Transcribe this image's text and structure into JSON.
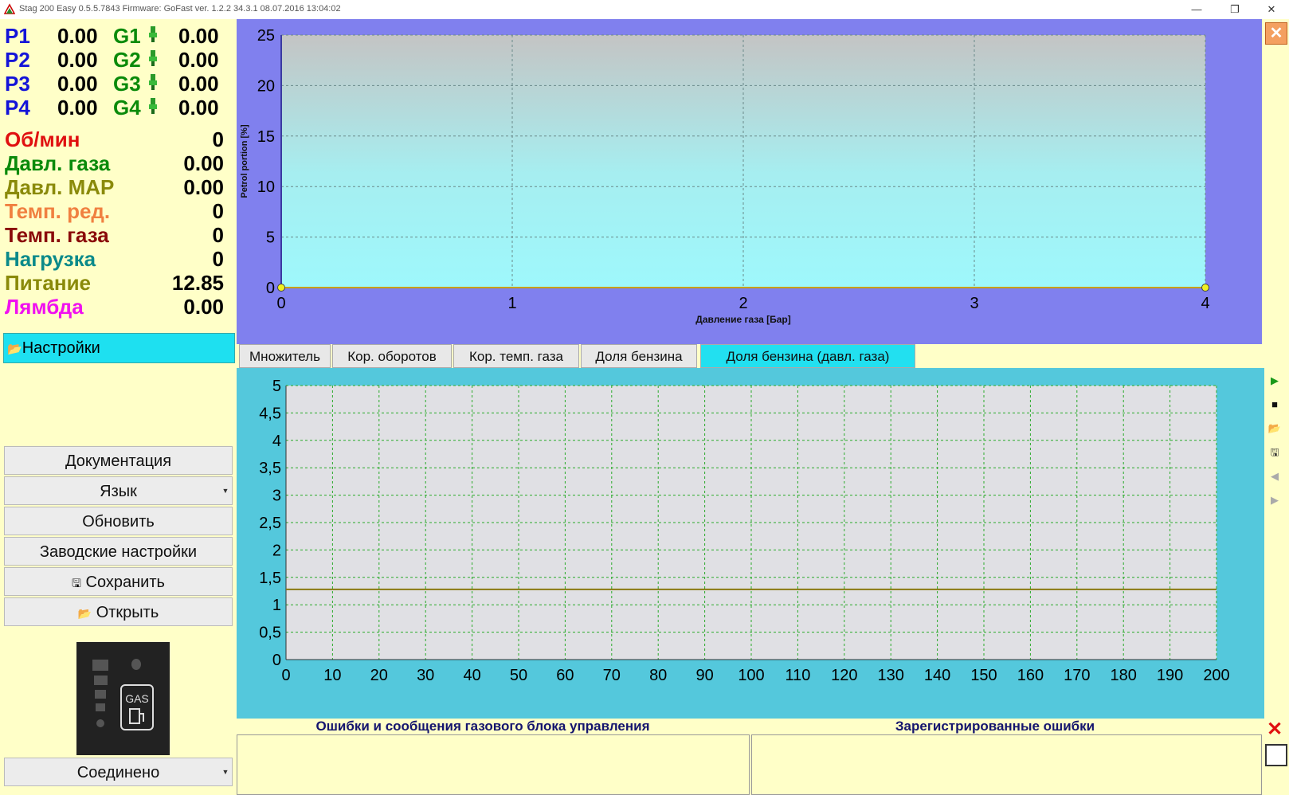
{
  "window": {
    "title": "Stag 200 Easy 0.5.5.7843 Firmware: GoFast  ver. 1.2.2  34.3.1   08.07.2016 13:04:02",
    "minimize": "—",
    "restore": "❐",
    "close": "✕"
  },
  "injectors": [
    {
      "p_label": "P1",
      "p_value": "0.00",
      "g_label": "G1",
      "g_value": "0.00"
    },
    {
      "p_label": "P2",
      "p_value": "0.00",
      "g_label": "G2",
      "g_value": "0.00"
    },
    {
      "p_label": "P3",
      "p_value": "0.00",
      "g_label": "G3",
      "g_value": "0.00"
    },
    {
      "p_label": "P4",
      "p_value": "0.00",
      "g_label": "G4",
      "g_value": "0.00"
    }
  ],
  "sensors": [
    {
      "label": "Об/мин",
      "value": "0",
      "color": "#e01010"
    },
    {
      "label": "Давл. газа",
      "value": "0.00",
      "color": "#0a8a0a"
    },
    {
      "label": "Давл. MAP",
      "value": "0.00",
      "color": "#8a8a0a"
    },
    {
      "label": "Темп. ред.",
      "value": "0",
      "color": "#f08040"
    },
    {
      "label": "Темп. газа",
      "value": "0",
      "color": "#8a0a0a"
    },
    {
      "label": "Нагрузка",
      "value": "0",
      "color": "#0a8a8a"
    },
    {
      "label": "Питание",
      "value": "12.85",
      "color": "#8a8a0a"
    },
    {
      "label": "Лямбда",
      "value": "0.00",
      "color": "#f010f0"
    }
  ],
  "settings_label": "Настройки",
  "buttons": {
    "documentation": "Документация",
    "language": "Язык",
    "refresh": "Обновить",
    "factory": "Заводские настройки",
    "save": "Сохранить",
    "open": "Открыть",
    "connection": "Соединено"
  },
  "gas_indicator": {
    "label": "GAS"
  },
  "tabs": [
    {
      "label": "Множитель",
      "active": false
    },
    {
      "label": "Кор. оборотов",
      "active": false
    },
    {
      "label": "Кор. темп. газа",
      "active": false
    },
    {
      "label": "Доля бензина",
      "active": false
    },
    {
      "label": "Доля бензина (давл. газа)",
      "active": true
    }
  ],
  "errors": {
    "ecu_messages_title": "Ошибки и сообщения газового блока управления",
    "registered_title": "Зарегистрированные ошибки"
  },
  "chart_data": [
    {
      "type": "line",
      "xlabel": "Давление газа [Бар]",
      "ylabel": "Petrol portion [%]",
      "xlim": [
        0,
        4
      ],
      "ylim": [
        0,
        25
      ],
      "x_ticks": [
        "0",
        "1",
        "2",
        "3",
        "4"
      ],
      "y_ticks": [
        "0",
        "5",
        "10",
        "15",
        "20",
        "25"
      ],
      "series": [
        {
          "x": [
            0,
            4
          ],
          "y": [
            0,
            0
          ],
          "color": "#c8a000"
        }
      ],
      "grid": true
    },
    {
      "type": "line",
      "xlim": [
        0,
        200
      ],
      "ylim": [
        0,
        5
      ],
      "x_ticks": [
        "0",
        "10",
        "20",
        "30",
        "40",
        "50",
        "60",
        "70",
        "80",
        "90",
        "100",
        "110",
        "120",
        "130",
        "140",
        "150",
        "160",
        "170",
        "180",
        "190",
        "200"
      ],
      "y_ticks": [
        "0",
        "0,5",
        "1",
        "1,5",
        "2",
        "2,5",
        "3",
        "3,5",
        "4",
        "4,5",
        "5"
      ],
      "series": [
        {
          "x": [
            0,
            200
          ],
          "y": [
            1.28,
            1.28
          ],
          "color": "#8a7a10"
        }
      ],
      "grid": true
    }
  ]
}
